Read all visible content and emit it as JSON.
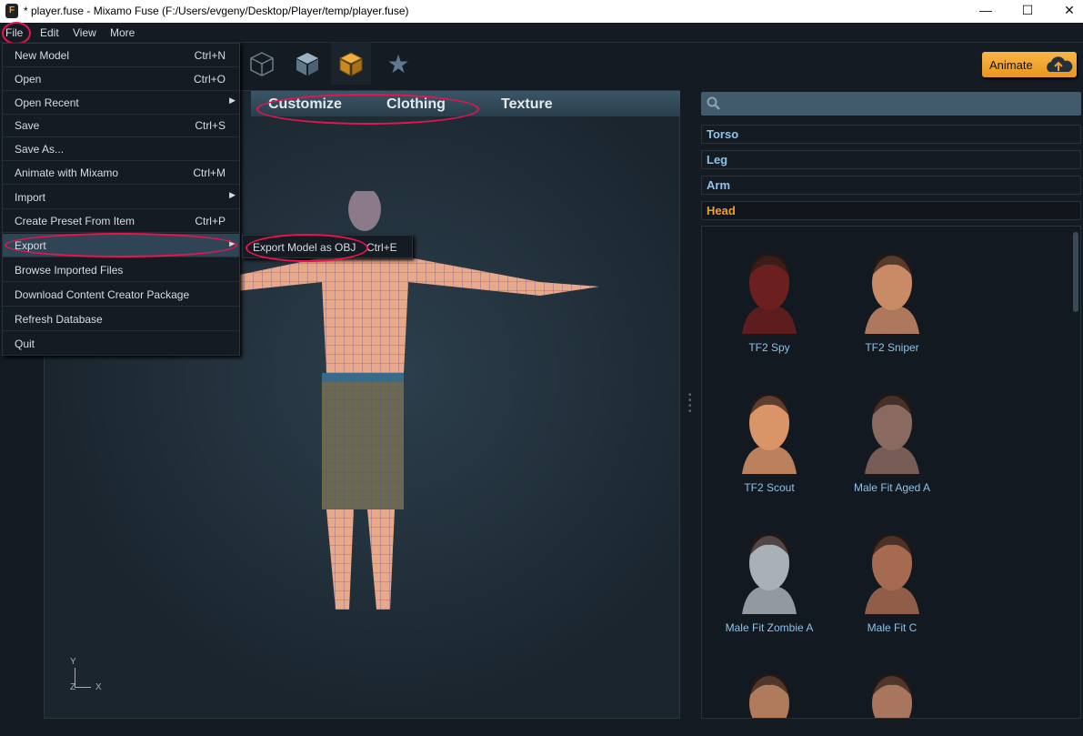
{
  "window": {
    "title": "* player.fuse - Mixamo Fuse (F:/Users/evgeny/Desktop/Player/temp/player.fuse)",
    "minimize": "—",
    "maximize": "☐",
    "close": "✕"
  },
  "menubar": [
    "File",
    "Edit",
    "View",
    "More"
  ],
  "file_menu": [
    {
      "label": "New Model",
      "shortcut": "Ctrl+N"
    },
    {
      "label": "Open",
      "shortcut": "Ctrl+O"
    },
    {
      "label": "Open Recent",
      "submenu": true
    },
    {
      "label": "Save",
      "shortcut": "Ctrl+S"
    },
    {
      "label": "Save As..."
    },
    {
      "label": "Animate with Mixamo",
      "shortcut": "Ctrl+M"
    },
    {
      "label": "Import",
      "submenu": true
    },
    {
      "label": "Create Preset From Item",
      "shortcut": "Ctrl+P"
    },
    {
      "label": "Export",
      "submenu": true,
      "highlighted": true
    },
    {
      "label": "Browse Imported Files"
    },
    {
      "label": "Download Content Creator Package"
    },
    {
      "label": "Refresh Database"
    },
    {
      "label": "Quit"
    }
  ],
  "export_submenu": {
    "label": "Export Model as OBJ",
    "shortcut": "Ctrl+E"
  },
  "toolbar": {
    "icons": [
      "wireframe-cube-icon",
      "solid-cube-icon",
      "textured-cube-icon",
      "star-icon"
    ],
    "animate_label": "Animate"
  },
  "tabs": [
    "Customize",
    "Clothing",
    "Texture"
  ],
  "axis": {
    "y": "Y",
    "z": "Z",
    "x": "X"
  },
  "categories": [
    {
      "label": "Torso"
    },
    {
      "label": "Leg"
    },
    {
      "label": "Arm"
    },
    {
      "label": "Head",
      "active": true
    }
  ],
  "items": [
    {
      "label": "TF2 Spy",
      "color": "#6b1f1f"
    },
    {
      "label": "TF2 Sniper",
      "color": "#c98a66"
    },
    {
      "label": "TF2 Scout",
      "color": "#d99468"
    },
    {
      "label": "Male Fit Aged A",
      "color": "#8a6a60"
    },
    {
      "label": "Male Fit Zombie A",
      "color": "#a9b0b8"
    },
    {
      "label": "Male Fit C",
      "color": "#a66a50"
    },
    {
      "label": "",
      "color": "#b07a5c"
    },
    {
      "label": "",
      "color": "#a8765e"
    }
  ],
  "colors": {
    "accent": "#f0a030",
    "highlight_ring": "#e8144f",
    "category_text": "#8cc3ea"
  }
}
